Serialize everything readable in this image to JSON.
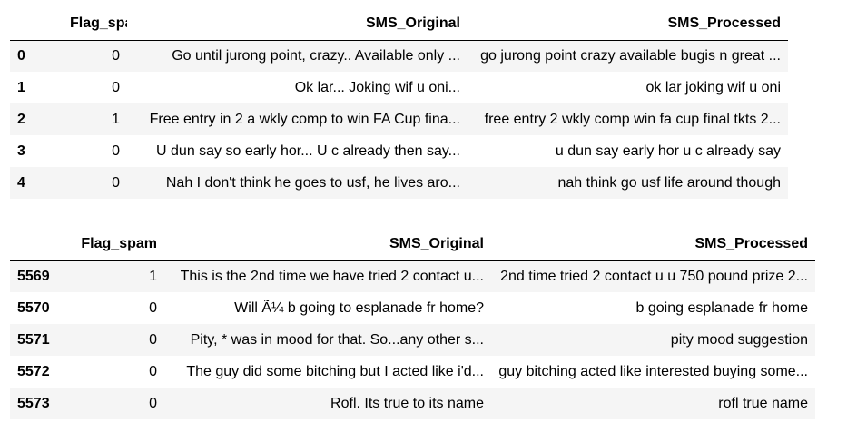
{
  "head_table": {
    "columns": [
      "",
      "Flag_spam",
      "SMS_Original",
      "SMS_Processed"
    ],
    "rows": [
      {
        "index": "0",
        "flag_spam": "0",
        "sms_original": "Go until jurong point, crazy.. Available only ...",
        "sms_processed": "go jurong point crazy available bugis n great ..."
      },
      {
        "index": "1",
        "flag_spam": "0",
        "sms_original": "Ok lar... Joking wif u oni...",
        "sms_processed": "ok lar joking wif u oni"
      },
      {
        "index": "2",
        "flag_spam": "1",
        "sms_original": "Free entry in 2 a wkly comp to win FA Cup fina...",
        "sms_processed": "free entry 2 wkly comp win fa cup final tkts 2..."
      },
      {
        "index": "3",
        "flag_spam": "0",
        "sms_original": "U dun say so early hor... U c already then say...",
        "sms_processed": "u dun say early hor u c already say"
      },
      {
        "index": "4",
        "flag_spam": "0",
        "sms_original": "Nah I don't think he goes to usf, he lives aro...",
        "sms_processed": "nah think go usf life around though"
      }
    ]
  },
  "tail_table": {
    "columns": [
      "",
      "Flag_spam",
      "SMS_Original",
      "SMS_Processed"
    ],
    "rows": [
      {
        "index": "5569",
        "flag_spam": "1",
        "sms_original": "This is the 2nd time we have tried 2 contact u...",
        "sms_processed": "2nd time tried 2 contact u u 750 pound prize 2..."
      },
      {
        "index": "5570",
        "flag_spam": "0",
        "sms_original": "Will Ã¼ b going to esplanade fr home?",
        "sms_processed": "b going esplanade fr home"
      },
      {
        "index": "5571",
        "flag_spam": "0",
        "sms_original": "Pity, * was in mood for that. So...any other s...",
        "sms_processed": "pity mood suggestion"
      },
      {
        "index": "5572",
        "flag_spam": "0",
        "sms_original": "The guy did some bitching but I acted like i'd...",
        "sms_processed": "guy bitching acted like interested buying some..."
      },
      {
        "index": "5573",
        "flag_spam": "0",
        "sms_original": "Rofl. Its true to its name",
        "sms_processed": "rofl true name"
      }
    ]
  }
}
